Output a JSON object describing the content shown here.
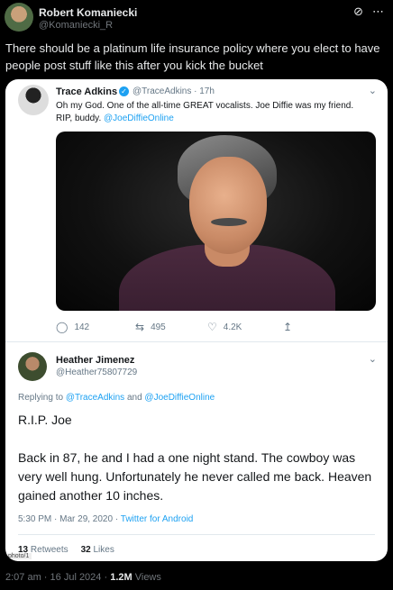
{
  "post": {
    "author_name": "Robert Komaniecki",
    "author_handle": "@Komaniecki_R",
    "text": "There should be a platinum life insurance policy where you elect to have people post stuff like this after you kick the bucket",
    "time": "2:07 am",
    "date": "16 Jul 2024",
    "views_count": "1.2M",
    "views_label": "Views"
  },
  "quoted1": {
    "name": "Trace Adkins",
    "handle": "@TraceAdkins",
    "age": "17h",
    "text_before": "Oh my God. One of the all-time GREAT vocalists. Joe Diffie was my friend. RIP, buddy. ",
    "mention": "@JoeDiffieOnline",
    "replies": "142",
    "retweets": "495",
    "likes": "4.2K"
  },
  "quoted2": {
    "name": "Heather Jimenez",
    "handle": "@Heather75807729",
    "replying_prefix": "Replying to ",
    "replying_mention1": "@TraceAdkins",
    "replying_and": " and ",
    "replying_mention2": "@JoeDiffieOnline",
    "body_line1": "R.I.P. Joe",
    "body_line2": "Back in 87, he and I had a one night stand.  The cowboy was very well hung.  Unfortunately he never called me back.  Heaven gained another 10 inches.",
    "timestamp": "5:30 PM · Mar 29, 2020 · ",
    "source": "Twitter for Android",
    "retweets_count": "13",
    "retweets_label": "Retweets",
    "likes_count": "32",
    "likes_label": "Likes",
    "photo_badge": "photo/1"
  },
  "icons": {
    "grok": "slash-circle-icon",
    "more": "more-icon",
    "verified": "verified-badge-icon",
    "chevron": "chevron-down-icon",
    "reply": "reply-icon",
    "retweet": "retweet-icon",
    "like": "heart-icon",
    "share": "share-icon"
  }
}
